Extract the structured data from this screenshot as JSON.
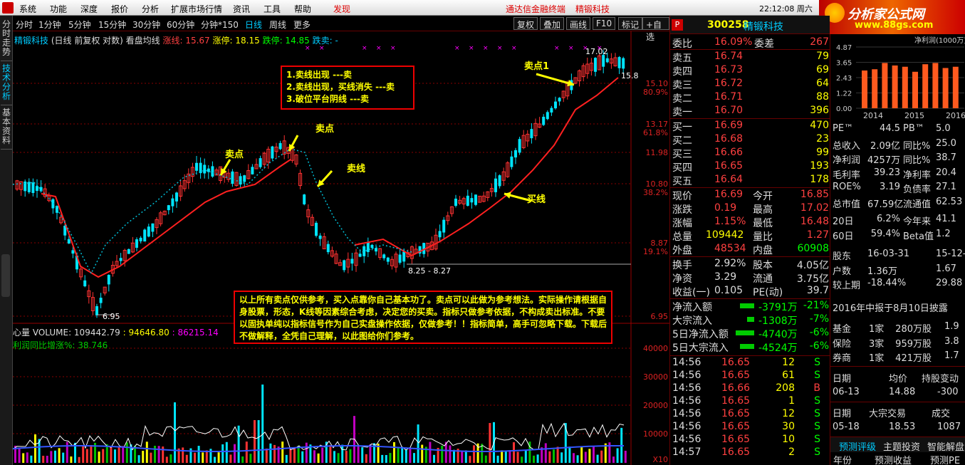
{
  "menu": {
    "items": [
      "系统",
      "功能",
      "深度",
      "报价",
      "分析",
      "扩展市场行情",
      "资讯",
      "工具",
      "帮助"
    ],
    "discover": "发现",
    "broker": "通达信金融终端",
    "company": "精锻科技",
    "clock": "22:12:08 周六"
  },
  "brand": {
    "title": "分析家公式网",
    "url": "www.88gs.com"
  },
  "left_tabs": [
    "分时走势",
    "技术分析",
    "基本资料"
  ],
  "periods": [
    "分时",
    "1分钟",
    "5分钟",
    "15分钟",
    "30分钟",
    "60分钟",
    "分钟*150",
    "日线",
    "周线",
    "更多"
  ],
  "toolbar": [
    "复权",
    "叠加",
    "画线",
    "F10",
    "标记",
    "+自选"
  ],
  "chart_header": {
    "name": "精锻科技",
    "mode": "(日线 前复权 对数) 看盘均线",
    "sell_line": "涨线: 15.67",
    "limit_up": "涨停: 18.15",
    "limit_down": "跌停: 14.85",
    "down_sell": "跌卖: -"
  },
  "price_axis": [
    "15.10",
    "13.17",
    "11.98",
    "10.80",
    "8.87",
    "6.95"
  ],
  "pct_axis": [
    "80.9%",
    "61.8%",
    "38.2%",
    "19.1%"
  ],
  "vol_header": {
    "label": "心量 VOLUME: 109442.79",
    "v2": ": 94646.80",
    "v3": ": 86215.14"
  },
  "profit_line": "利润同比增涨%: 38.746",
  "vol_axis": [
    "40000",
    "30000",
    "20000",
    "10000"
  ],
  "vol_unit": "X10",
  "markers": {
    "high": "17.02",
    "range": "8.25 - 8.27",
    "low": "6.95",
    "right_tick": "15.8"
  },
  "annotations": {
    "sell1": "卖点",
    "sell2": "卖点",
    "sell3": "卖点1",
    "sellline": "卖线",
    "buyline": "买线"
  },
  "rules_box": [
    "1.卖线出现 ---卖",
    "2.卖线出现，买线消失 ---卖",
    "3.破位平台阴线 ---卖"
  ],
  "disclaimer": "以上所有卖点仅供参考，买入点靠你自己基本功了。卖点可以此做为参考想法。实际操作请根据自身股票，形态，K线等因素综合考虑，决定您的买卖。指标只做参考依据，不构成卖出标准。不要以固执单纯以指标信号作为自己实盘操作依据，仅做参考！！指标简单，高手可忽略下载。下载后不做解释，全凭自己理解，以此图给你们参考。",
  "quote": {
    "code": "300258",
    "name": "精锻科技",
    "webi": {
      "label": "委比",
      "value": "16.09%",
      "label2": "委差",
      "value2": "267"
    },
    "asks": [
      {
        "label": "卖五",
        "price": "16.74",
        "vol": "79"
      },
      {
        "label": "卖四",
        "price": "16.73",
        "vol": "69"
      },
      {
        "label": "卖三",
        "price": "16.72",
        "vol": "64"
      },
      {
        "label": "卖二",
        "price": "16.71",
        "vol": "88"
      },
      {
        "label": "卖一",
        "price": "16.70",
        "vol": "396"
      }
    ],
    "bids": [
      {
        "label": "买一",
        "price": "16.69",
        "vol": "470"
      },
      {
        "label": "买二",
        "price": "16.68",
        "vol": "23"
      },
      {
        "label": "买三",
        "price": "16.66",
        "vol": "99"
      },
      {
        "label": "买四",
        "price": "16.65",
        "vol": "193"
      },
      {
        "label": "买五",
        "price": "16.64",
        "vol": "178"
      }
    ],
    "stats": [
      {
        "l1": "现价",
        "v1": "16.69",
        "l2": "今开",
        "v2": "16.85"
      },
      {
        "l1": "涨跌",
        "v1": "0.19",
        "l2": "最高",
        "v2": "17.02"
      },
      {
        "l1": "涨幅",
        "v1": "1.15%",
        "l2": "最低",
        "v2": "16.48"
      },
      {
        "l1": "总量",
        "v1": "109442",
        "l2": "量比",
        "v2": "1.27"
      },
      {
        "l1": "外盘",
        "v1": "48534",
        "l2": "内盘",
        "v2": "60908"
      }
    ],
    "stats2": [
      {
        "l1": "换手",
        "v1": "2.92%",
        "l2": "股本",
        "v2": "4.05亿"
      },
      {
        "l1": "净资",
        "v1": "3.29",
        "l2": "流通",
        "v2": "3.75亿"
      },
      {
        "l1": "收益(一)",
        "v1": "0.105",
        "l2": "PE(动)",
        "v2": "39.7"
      }
    ],
    "flows": [
      {
        "label": "净流入额",
        "value": "-3791万",
        "pct": "-21%"
      },
      {
        "label": "大宗流入",
        "value": "-1308万",
        "pct": "-7%"
      },
      {
        "label": "5日净流入额",
        "value": "-4740万",
        "pct": "-6%"
      },
      {
        "label": "5日大宗流入",
        "value": "-4524万",
        "pct": "-6%"
      }
    ],
    "ticks": [
      {
        "t": "14:56",
        "p": "16.65",
        "v": "12",
        "s": "S"
      },
      {
        "t": "14:56",
        "p": "16.65",
        "v": "61",
        "s": "S"
      },
      {
        "t": "14:56",
        "p": "16.66",
        "v": "208",
        "s": "B"
      },
      {
        "t": "14:56",
        "p": "16.65",
        "v": "1",
        "s": "S"
      },
      {
        "t": "14:56",
        "p": "16.65",
        "v": "12",
        "s": "S"
      },
      {
        "t": "14:56",
        "p": "16.65",
        "v": "30",
        "s": "S"
      },
      {
        "t": "14:56",
        "p": "16.65",
        "v": "10",
        "s": "S"
      },
      {
        "t": "14:57",
        "p": "16.65",
        "v": "2",
        "s": "S"
      }
    ]
  },
  "fundamentals": {
    "bar_axis": [
      "4.87",
      "3.65",
      "2.43",
      "1.22",
      "0.00"
    ],
    "bar_years": [
      "2014",
      "2015",
      "2016"
    ],
    "bar_title": "净利润(1000万)",
    "bar_values": [
      3.0,
      3.1,
      3.6,
      3.4,
      3.3,
      2.9,
      3.5,
      3.6,
      3.2,
      3.3
    ],
    "rows": [
      {
        "a": "PE™",
        "b": "44.5",
        "c": "PB™",
        "d": "5.0"
      },
      {
        "a": "总收入",
        "b": "2.09亿",
        "c": "同比%",
        "d": "25.0"
      },
      {
        "a": "净利润",
        "b": "4257万",
        "c": "同比%",
        "d": "38.7"
      },
      {
        "a": "毛利率",
        "b": "39.23",
        "c": "净利率",
        "d": "20.4"
      },
      {
        "a": "ROE%",
        "b": "3.19",
        "c": "负债率",
        "d": "27.1"
      },
      {
        "a": "总市值",
        "b": "67.59亿",
        "c": "流通值",
        "d": "62.53"
      },
      {
        "a": "20日",
        "b": "6.2%",
        "c": "今年来",
        "d": "41.1"
      },
      {
        "a": "60日",
        "b": "59.4%",
        "c": "Beta值",
        "d": "1.2"
      },
      {
        "a": "股东",
        "b": "16-03-31",
        "c": "",
        "d": "15-12-3"
      },
      {
        "a": "户数",
        "b": "1.36万",
        "c": "",
        "d": "1.67"
      },
      {
        "a": "较上期",
        "b": "-18.44%",
        "c": "",
        "d": "29.88"
      }
    ],
    "report_note": "2016年中报于8月10日披露",
    "holders": [
      {
        "a": "基金",
        "b": "1家",
        "c": "280万股",
        "d": "1.9"
      },
      {
        "a": "保险",
        "b": "3家",
        "c": "959万股",
        "d": "3.8"
      },
      {
        "a": "券商",
        "b": "1家",
        "c": "421万股",
        "d": "1.7"
      }
    ],
    "date_hdr": {
      "a": "日期",
      "b": "均价",
      "c": "持股变动"
    },
    "date_row": {
      "a": "06-13",
      "b": "14.88",
      "c": "-300"
    },
    "block_hdr": {
      "a": "日期",
      "b": "大宗交易",
      "c": "成交"
    },
    "block_row": {
      "a": "05-18",
      "b": "18.53",
      "c": "1087"
    },
    "tabs": [
      "预测评级",
      "主题投资",
      "智能解盘"
    ],
    "bottom": [
      "年份",
      "预测收益",
      "预测PE"
    ]
  },
  "colors": {
    "up": "#ff3232",
    "down": "#00e5ff",
    "yellow": "#ffff00",
    "bg": "#000000",
    "grid": "#600000"
  }
}
